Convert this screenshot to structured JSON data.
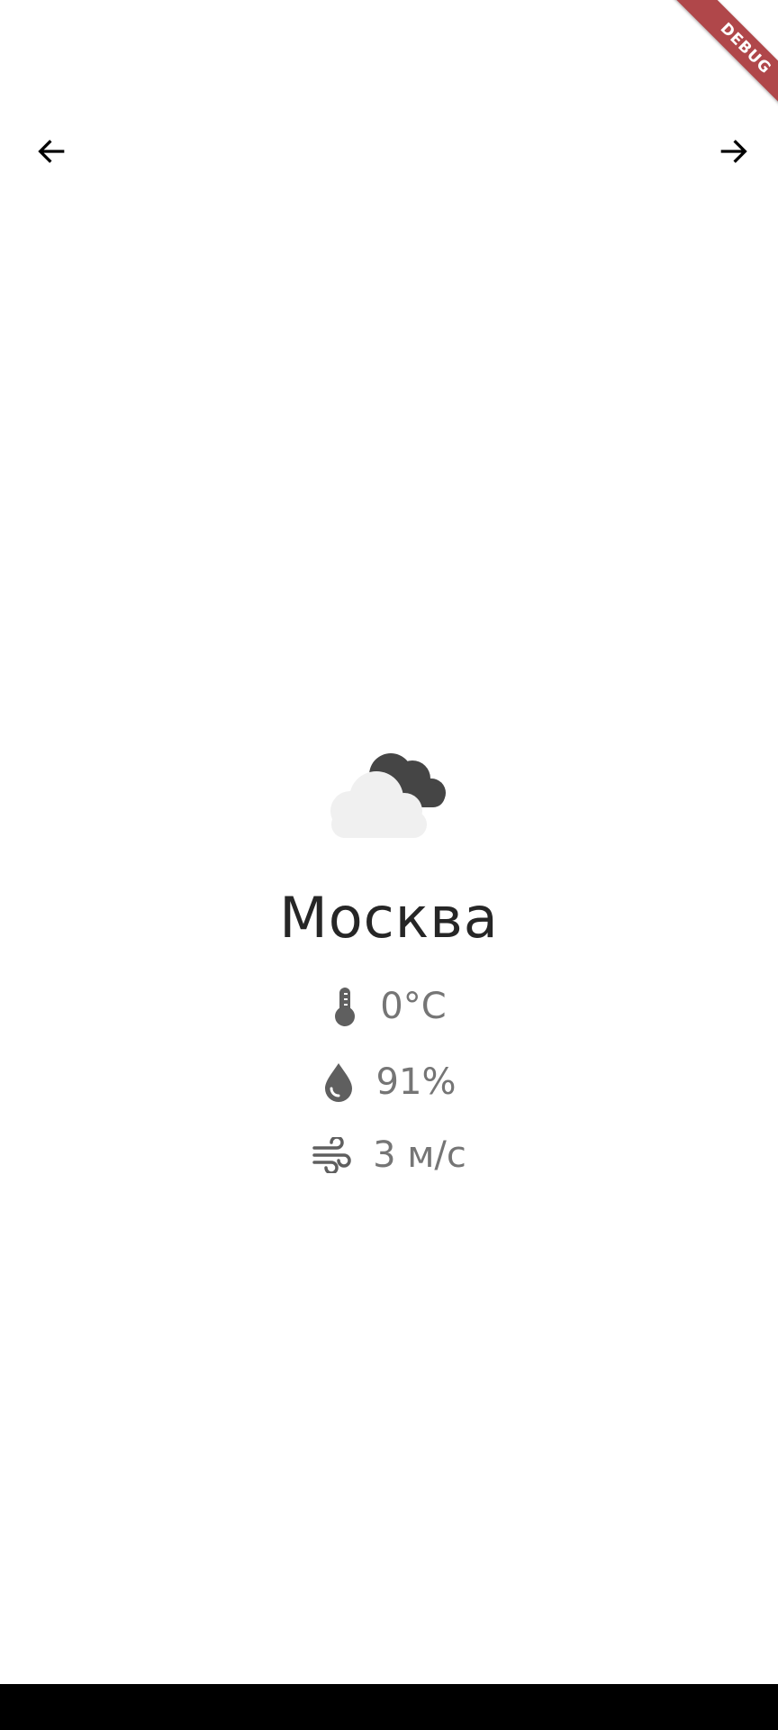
{
  "banner": {
    "label": "DEBUG",
    "color": "#b0474a"
  },
  "navigation": {
    "prev_icon": "arrow-left-icon",
    "next_icon": "arrow-right-icon"
  },
  "weather": {
    "condition_icon": "cloudy-night-icon",
    "city": "Москва",
    "temperature": "0°C",
    "temperature_icon": "thermometer-icon",
    "humidity": "91%",
    "humidity_icon": "water-drop-icon",
    "wind": "3 м/с",
    "wind_icon": "wind-icon"
  },
  "colors": {
    "text_primary": "#262626",
    "text_secondary": "#757575",
    "icon": "#5f5f5f"
  }
}
